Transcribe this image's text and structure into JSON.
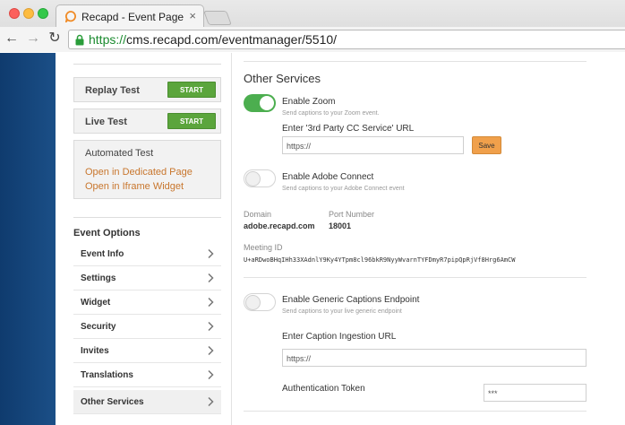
{
  "browser": {
    "tab_title": "Recapd - Event Page",
    "tab_close": "×",
    "url_scheme": "https://",
    "url_rest": "cms.recapd.com/eventmanager/5510/",
    "back": "←",
    "forward": "→",
    "reload": "↻"
  },
  "left_panel": {
    "replay_test": {
      "label": "Replay Test",
      "button": "START"
    },
    "live_test": {
      "label": "Live Test",
      "button": "START"
    },
    "automated_test": {
      "label": "Automated Test",
      "links": [
        "Open in Dedicated Page",
        "Open in Iframe Widget"
      ]
    },
    "event_options": {
      "title": "Event Options",
      "items": [
        "Event Info",
        "Settings",
        "Widget",
        "Security",
        "Invites",
        "Translations",
        "Other Services"
      ],
      "active": "Other Services"
    }
  },
  "other_services": {
    "title": "Other Services",
    "zoom": {
      "label": "Enable Zoom",
      "sub": "Send captions to your Zoom event.",
      "enabled": true,
      "url_label": "Enter '3rd Party CC Service' URL",
      "url_value": "https://",
      "save": "Save"
    },
    "adobe": {
      "label": "Enable Adobe Connect",
      "sub": "Send captions to your Adobe Connect event",
      "enabled": false,
      "domain_label": "Domain",
      "domain_value": "adobe.recapd.com",
      "port_label": "Port Number",
      "port_value": "18001",
      "meeting_label": "Meeting ID",
      "meeting_value": "U+aRDwoBHqIHh33XAdnlY9Ky4YTpm8cl96bkR9NyyWvarnTYFDmyR7pipQpRjVf8Hrg6AmCW"
    },
    "generic": {
      "label": "Enable Generic Captions Endpoint",
      "sub": "Send captions to your live generic endpoint",
      "enabled": false,
      "ingestion_label": "Enter Caption Ingestion URL",
      "ingestion_value": "https://",
      "token_label": "Authentication Token",
      "token_value": "***"
    }
  },
  "colors": {
    "sidebar_blue": "#1b4f87",
    "start_green": "#5ba53c",
    "toggle_green": "#4cae4f",
    "link_orange": "#c8762d",
    "save_orange": "#f0a04b",
    "url_green": "#1a8a2e"
  }
}
